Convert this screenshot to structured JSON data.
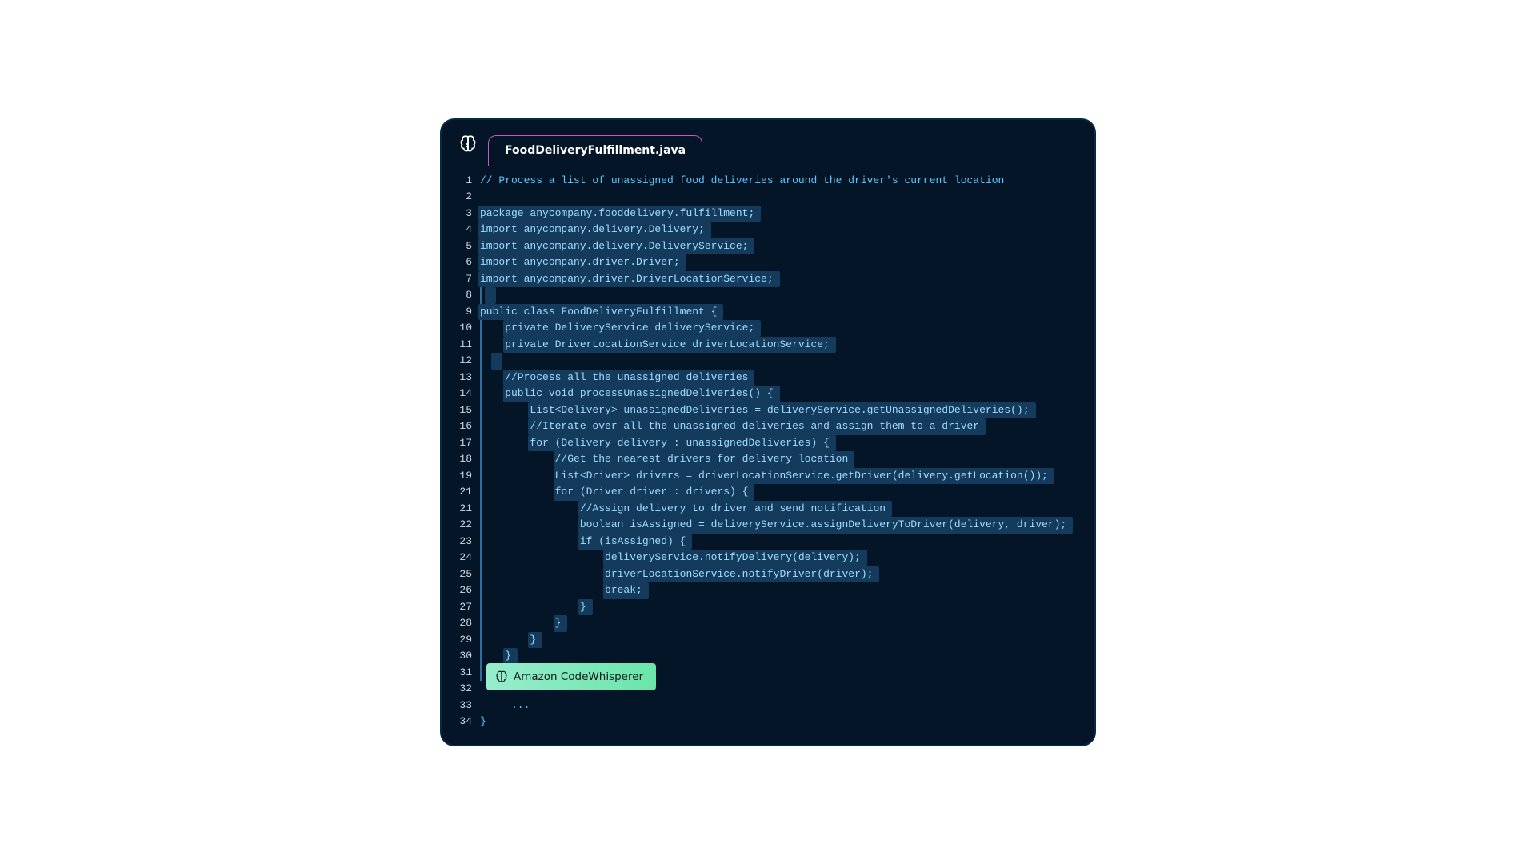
{
  "tab": {
    "title": "FoodDeliveryFulfillment.java"
  },
  "badge": {
    "label": "Amazon CodeWhisperer"
  },
  "lines": [
    {
      "n": "1",
      "t": "// Process a list of unassigned food deliveries around the driver's current location",
      "hl": false
    },
    {
      "n": "2",
      "t": "",
      "hl": false
    },
    {
      "n": "3",
      "t": "package anycompany.fooddelivery.fulfillment;",
      "hl": true
    },
    {
      "n": "4",
      "t": "import anycompany.delivery.Delivery;",
      "hl": true
    },
    {
      "n": "5",
      "t": "import anycompany.delivery.DeliveryService;",
      "hl": true
    },
    {
      "n": "6",
      "t": "import anycompany.driver.Driver;",
      "hl": true
    },
    {
      "n": "7",
      "t": "import anycompany.driver.DriverLocationService;",
      "hl": true
    },
    {
      "n": "8",
      "t": " ",
      "hl": true
    },
    {
      "n": "9",
      "t": "public class FoodDeliveryFulfillment {",
      "hl": true
    },
    {
      "n": "10",
      "t": "    private DeliveryService deliveryService;",
      "hl": true
    },
    {
      "n": "11",
      "t": "    private DriverLocationService driverLocationService;",
      "hl": true
    },
    {
      "n": "12",
      "t": "  ",
      "hl": true
    },
    {
      "n": "13",
      "t": "    //Process all the unassigned deliveries",
      "hl": true
    },
    {
      "n": "14",
      "t": "    public void processUnassignedDeliveries() {",
      "hl": true
    },
    {
      "n": "15",
      "t": "        List<Delivery> unassignedDeliveries = deliveryService.getUnassignedDeliveries();",
      "hl": true
    },
    {
      "n": "16",
      "t": "        //Iterate over all the unassigned deliveries and assign them to a driver",
      "hl": true
    },
    {
      "n": "17",
      "t": "        for (Delivery delivery : unassignedDeliveries) {",
      "hl": true
    },
    {
      "n": "18",
      "t": "            //Get the nearest drivers for delivery location",
      "hl": true
    },
    {
      "n": "19",
      "t": "            List<Driver> drivers = driverLocationService.getDriver(delivery.getLocation());",
      "hl": true
    },
    {
      "n": "21",
      "t": "            for (Driver driver : drivers) {",
      "hl": true
    },
    {
      "n": "21",
      "t": "                //Assign delivery to driver and send notification",
      "hl": true
    },
    {
      "n": "22",
      "t": "                boolean isAssigned = deliveryService.assignDeliveryToDriver(delivery, driver);",
      "hl": true
    },
    {
      "n": "23",
      "t": "                if (isAssigned) {",
      "hl": true
    },
    {
      "n": "24",
      "t": "                    deliveryService.notifyDelivery(delivery);",
      "hl": true
    },
    {
      "n": "25",
      "t": "                    driverLocationService.notifyDriver(driver);",
      "hl": true
    },
    {
      "n": "26",
      "t": "                    break;",
      "hl": true
    },
    {
      "n": "27",
      "t": "                }",
      "hl": true
    },
    {
      "n": "28",
      "t": "            }",
      "hl": true
    },
    {
      "n": "29",
      "t": "        }",
      "hl": true
    },
    {
      "n": "30",
      "t": "    }",
      "hl": true
    },
    {
      "n": "31",
      "t": "",
      "hl": false,
      "badge": true
    },
    {
      "n": "32",
      "t": "",
      "hl": false
    },
    {
      "n": "33",
      "t": "     ...",
      "hl": false
    },
    {
      "n": "34",
      "t": "}",
      "hl": false
    }
  ]
}
